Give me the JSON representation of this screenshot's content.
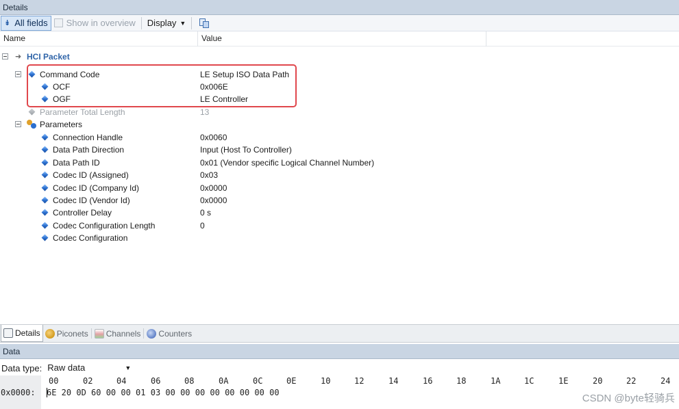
{
  "details_panel": {
    "title": "Details"
  },
  "toolbar": {
    "all_fields": "All fields",
    "show_in_overview": "Show in overview",
    "display": "Display"
  },
  "columns": {
    "name": "Name",
    "value": "Value"
  },
  "tree": {
    "root": "HCI Packet",
    "command_code": {
      "name": "Command Code",
      "value": "LE Setup ISO Data Path"
    },
    "ocf": {
      "name": "OCF",
      "value": "0x006E"
    },
    "ogf": {
      "name": "OGF",
      "value": "LE Controller"
    },
    "param_total_length": {
      "name": "Parameter Total Length",
      "value": "13"
    },
    "parameters": {
      "name": "Parameters"
    },
    "params": [
      {
        "name": "Connection Handle",
        "value": "0x0060"
      },
      {
        "name": "Data Path Direction",
        "value": "Input (Host To Controller)"
      },
      {
        "name": "Data Path ID",
        "value": "0x01 (Vendor specific Logical Channel Number)"
      },
      {
        "name": "Codec ID (Assigned)",
        "value": "0x03"
      },
      {
        "name": "Codec ID (Company Id)",
        "value": "0x0000"
      },
      {
        "name": "Codec ID (Vendor Id)",
        "value": "0x0000"
      },
      {
        "name": "Controller Delay",
        "value": "0 s"
      },
      {
        "name": "Codec Configuration Length",
        "value": "0"
      },
      {
        "name": "Codec Configuration",
        "value": ""
      }
    ]
  },
  "bottom_tabs": [
    "Details",
    "Piconets",
    "Channels",
    "Counters"
  ],
  "data_panel": {
    "title": "Data",
    "data_type_label": "Data type:",
    "data_type_value": "Raw data",
    "columns": [
      "00",
      "02",
      "04",
      "06",
      "08",
      "0A",
      "0C",
      "0E",
      "10",
      "12",
      "14",
      "16",
      "18",
      "1A",
      "1C",
      "1E",
      "20",
      "22",
      "24"
    ],
    "offset": "0x0000:",
    "bytes": "6E 20 0D 60 00 00 01 03 00 00 00 00 00 00 00 00"
  },
  "watermark": "CSDN @byte轻骑兵",
  "colors": {
    "highlight": "#e0474c",
    "header_bg": "#c9d5e3",
    "accent": "#2f64a8"
  }
}
